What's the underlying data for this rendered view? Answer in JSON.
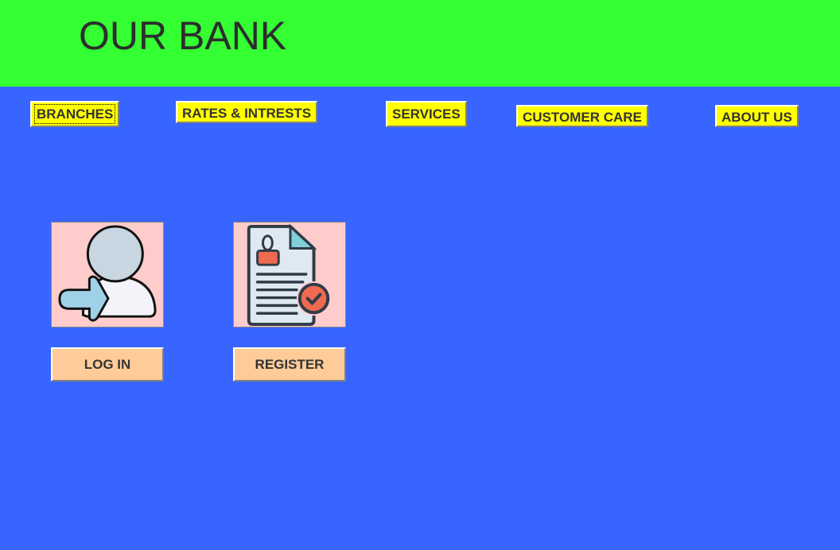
{
  "header": {
    "title": "OUR BANK"
  },
  "nav": [
    {
      "label": "BRANCHES"
    },
    {
      "label": "RATES & INTRESTS"
    },
    {
      "label": "SERVICES"
    },
    {
      "label": "CUSTOMER CARE"
    },
    {
      "label": "ABOUT US"
    }
  ],
  "actions": {
    "login_label": "LOG IN",
    "register_label": "REGISTER"
  },
  "colors": {
    "header": "#33ff33",
    "background": "#3865ff",
    "nav": "#ffff00",
    "button": "#ffcc99",
    "card": "#ffcccc"
  }
}
